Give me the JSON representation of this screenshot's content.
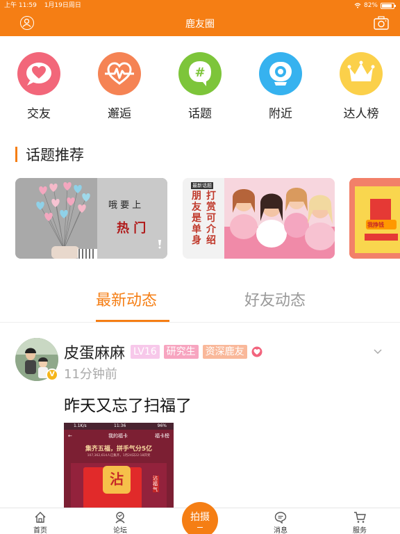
{
  "status": {
    "time": "上午 11:59",
    "date": "1月19日周日",
    "battery": "82%"
  },
  "nav": {
    "title": "鹿友圈"
  },
  "quick": [
    {
      "label": "交友",
      "icon": "heart-icon",
      "color": "#f2677a"
    },
    {
      "label": "邂逅",
      "icon": "pulse-icon",
      "color": "#f58354"
    },
    {
      "label": "话题",
      "icon": "hashtag-icon",
      "color": "#7dc53a"
    },
    {
      "label": "附近",
      "icon": "location-icon",
      "color": "#36b2ef"
    },
    {
      "label": "达人榜",
      "icon": "crown-icon",
      "color": "#fbd04a"
    }
  ],
  "section": {
    "title": "话题推荐"
  },
  "cards": [
    {
      "text1": "哦 要 上",
      "text2": "热 门"
    },
    {
      "badge": "最新话题",
      "text1": "打 赏 可 介 绍",
      "text2": "朋 友 是 单 身"
    },
    {
      "text1": "我挣钱"
    }
  ],
  "tabs": {
    "active": "最新动态",
    "inactive": "好友动态"
  },
  "post": {
    "name": "皮蛋麻麻",
    "level": "LV16",
    "role": "研究生",
    "senior": "资深鹿友",
    "time": "11分钟前",
    "text": "昨天又忘了扫福了",
    "image": {
      "status": "1.1K/s",
      "time": "11:36",
      "battery": "96%",
      "title": "我的福卡",
      "right": "福卡榜",
      "headline": "集齐五福，拼手气分5亿",
      "sub": "107,362,614人已集齐，1月24日22:18开奖",
      "card": "沾",
      "side": "沾福气"
    }
  },
  "bottom": [
    {
      "label": "首页",
      "icon": "home-icon"
    },
    {
      "label": "论坛",
      "icon": "forum-icon"
    },
    {
      "label": "拍摄",
      "icon": "camera-button"
    },
    {
      "label": "消息",
      "icon": "message-icon"
    },
    {
      "label": "服务",
      "icon": "cart-icon"
    }
  ],
  "colors": {
    "brand": "#f57e14"
  }
}
